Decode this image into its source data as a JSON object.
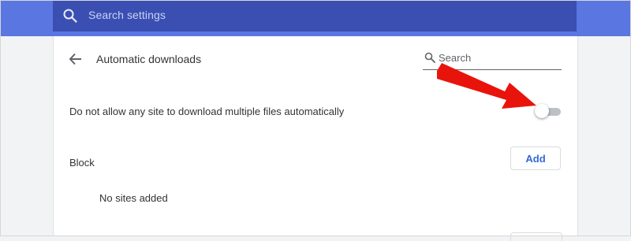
{
  "header": {
    "search_placeholder": "Search settings",
    "colors": {
      "bar": "#5a76e0",
      "search_field": "#3b4fb3"
    }
  },
  "subpage": {
    "back_icon": "arrow-left-icon",
    "title": "Automatic downloads",
    "search_icon": "search-icon",
    "search_placeholder": "Search"
  },
  "setting": {
    "label": "Do not allow any site to download multiple files automatically",
    "toggle_on": false
  },
  "block_section": {
    "title": "Block",
    "add_label": "Add",
    "empty_text": "No sites added"
  },
  "annotation": {
    "icon": "red-arrow-icon",
    "color": "#e8140c"
  }
}
